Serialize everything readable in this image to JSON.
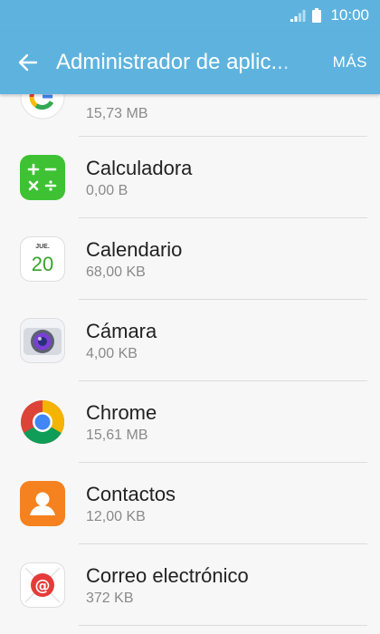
{
  "status_bar": {
    "time": "10:00"
  },
  "app_bar": {
    "title": "Administrador de aplic...",
    "more_label": "MÁS"
  },
  "apps": [
    {
      "name": "",
      "size": "15,73 MB",
      "icon": "google-icon"
    },
    {
      "name": "Calculadora",
      "size": "0,00 B",
      "icon": "calculator-icon"
    },
    {
      "name": "Calendario",
      "size": "68,00 KB",
      "icon": "calendar-icon",
      "icon_text": {
        "day": "JUE.",
        "date": "20"
      }
    },
    {
      "name": "Cámara",
      "size": "4,00 KB",
      "icon": "camera-icon"
    },
    {
      "name": "Chrome",
      "size": "15,61 MB",
      "icon": "chrome-icon"
    },
    {
      "name": "Contactos",
      "size": "12,00 KB",
      "icon": "contacts-icon"
    },
    {
      "name": "Correo electrónico",
      "size": "372 KB",
      "icon": "email-icon"
    }
  ],
  "colors": {
    "app_bar": "#5eb3de",
    "background": "#f7f7f7",
    "divider": "#dcdcdc"
  }
}
